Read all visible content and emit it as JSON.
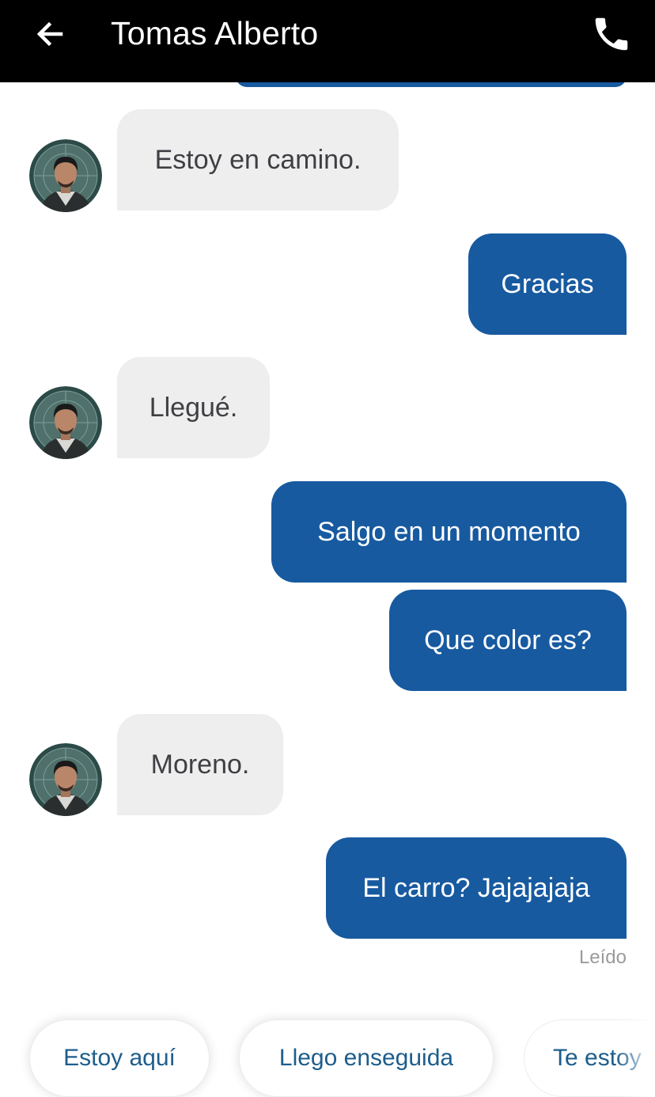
{
  "header": {
    "title": "Tomas Alberto",
    "back_icon": "arrow-left-icon",
    "call_icon": "phone-icon"
  },
  "colors": {
    "header_bg": "#000000",
    "outgoing_bubble": "#175aa0",
    "incoming_bubble": "#eeeeef",
    "chip_text": "#1c5d8c",
    "read_receipt": "#9b9b9b"
  },
  "messages": [
    {
      "direction": "incoming",
      "text": "Estoy en camino."
    },
    {
      "direction": "outgoing",
      "text": "Gracias"
    },
    {
      "direction": "incoming",
      "text": "Llegué."
    },
    {
      "direction": "outgoing",
      "text": "Salgo en un momento"
    },
    {
      "direction": "outgoing",
      "text": "Que color es?"
    },
    {
      "direction": "incoming",
      "text": "Moreno."
    },
    {
      "direction": "outgoing",
      "text": "El carro? Jajajajaja"
    }
  ],
  "read_receipt": "Leído",
  "quick_replies": [
    {
      "label": "Estoy aquí"
    },
    {
      "label": "Llego enseguida"
    },
    {
      "label": "Te estoy"
    }
  ]
}
